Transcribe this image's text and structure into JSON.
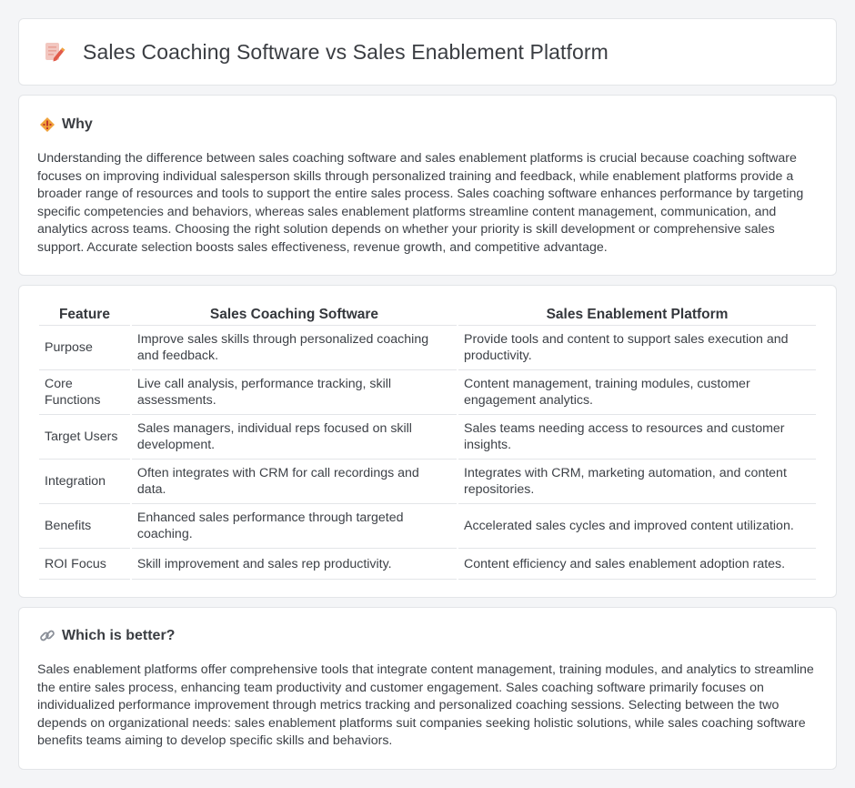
{
  "header": {
    "title": "Sales Coaching Software vs Sales Enablement Platform",
    "icon": "document-pencil-icon"
  },
  "why": {
    "icon": "diamond-warning-icon",
    "title": "Why",
    "text": "Understanding the difference between sales coaching software and sales enablement platforms is crucial because coaching software focuses on improving individual salesperson skills through personalized training and feedback, while enablement platforms provide a broader range of resources and tools to support the entire sales process. Sales coaching software enhances performance by targeting specific competencies and behaviors, whereas sales enablement platforms streamline content management, communication, and analytics across teams. Choosing the right solution depends on whether your priority is skill development or comprehensive sales support. Accurate selection boosts sales effectiveness, revenue growth, and competitive advantage."
  },
  "table": {
    "headers": [
      "Feature",
      "Sales Coaching Software",
      "Sales Enablement Platform"
    ],
    "rows": [
      [
        "Purpose",
        "Improve sales skills through personalized coaching and feedback.",
        "Provide tools and content to support sales execution and productivity."
      ],
      [
        "Core Functions",
        "Live call analysis, performance tracking, skill assessments.",
        "Content management, training modules, customer engagement analytics."
      ],
      [
        "Target Users",
        "Sales managers, individual reps focused on skill development.",
        "Sales teams needing access to resources and customer insights."
      ],
      [
        "Integration",
        "Often integrates with CRM for call recordings and data.",
        "Integrates with CRM, marketing automation, and content repositories."
      ],
      [
        "Benefits",
        "Enhanced sales performance through targeted coaching.",
        "Accelerated sales cycles and improved content utilization."
      ],
      [
        "ROI Focus",
        "Skill improvement and sales rep productivity.",
        "Content efficiency and sales enablement adoption rates."
      ]
    ]
  },
  "better": {
    "icon": "link-icon",
    "title": "Which is better?",
    "text": "Sales enablement platforms offer comprehensive tools that integrate content management, training modules, and analytics to streamline the entire sales process, enhancing team productivity and customer engagement. Sales coaching software primarily focuses on individualized performance improvement through metrics tracking and personalized coaching sessions. Selecting between the two depends on organizational needs: sales enablement platforms suit companies seeking holistic solutions, while sales coaching software benefits teams aiming to develop specific skills and behaviors."
  },
  "colors": {
    "background": "#f4f5f7",
    "card": "#ffffff",
    "border": "#e3e5e8",
    "accent_orange": "#e8a33d",
    "accent_red": "#e15b4a"
  }
}
